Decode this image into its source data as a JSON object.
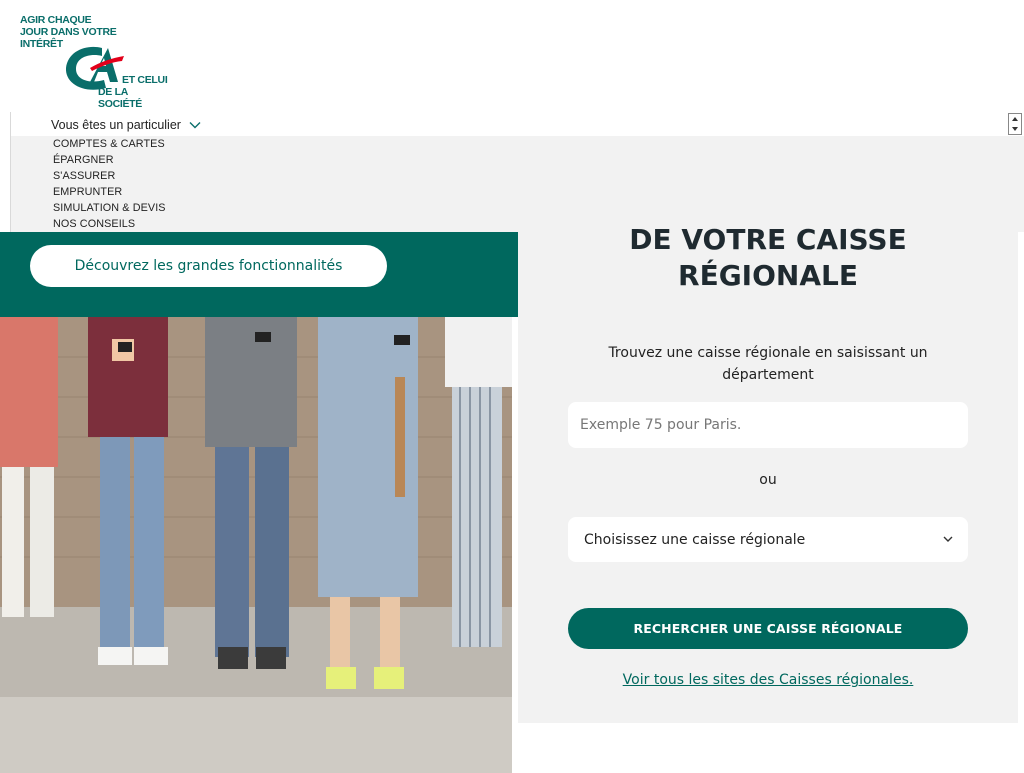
{
  "logo": {
    "tagline_lines": [
      "AGIR CHAQUE",
      "JOUR DANS VOTRE",
      "INTÉRÊT",
      "ET CELUI",
      "DE LA SOCIÉTÉ"
    ],
    "brand_mark": "CA",
    "colors": {
      "green": "#0a6e6a",
      "red": "#e2001a"
    }
  },
  "nav": {
    "segment_label": "Vous êtes un particulier",
    "menu_items": [
      "COMPTES & CARTES",
      "ÉPARGNER",
      "S'ASSURER",
      "EMPRUNTER",
      "SIMULATION & DEVIS",
      "NOS CONSEILS"
    ]
  },
  "promo": {
    "cta_label": "Découvrez les grandes fonctionnalités",
    "panel_color": "#00685e"
  },
  "finder": {
    "title_lines": [
      "DE VOTRE CAISSE",
      "RÉGIONALE"
    ],
    "description": "Trouvez une caisse régionale en saisissant un département",
    "input_placeholder": "Exemple 75 pour Paris.",
    "separator": "ou",
    "select_value": "Choisissez une caisse régionale",
    "search_button": "RECHERCHER UNE CAISSE RÉGIONALE",
    "all_sites_link": "Voir tous les sites des Caisses régionales."
  }
}
